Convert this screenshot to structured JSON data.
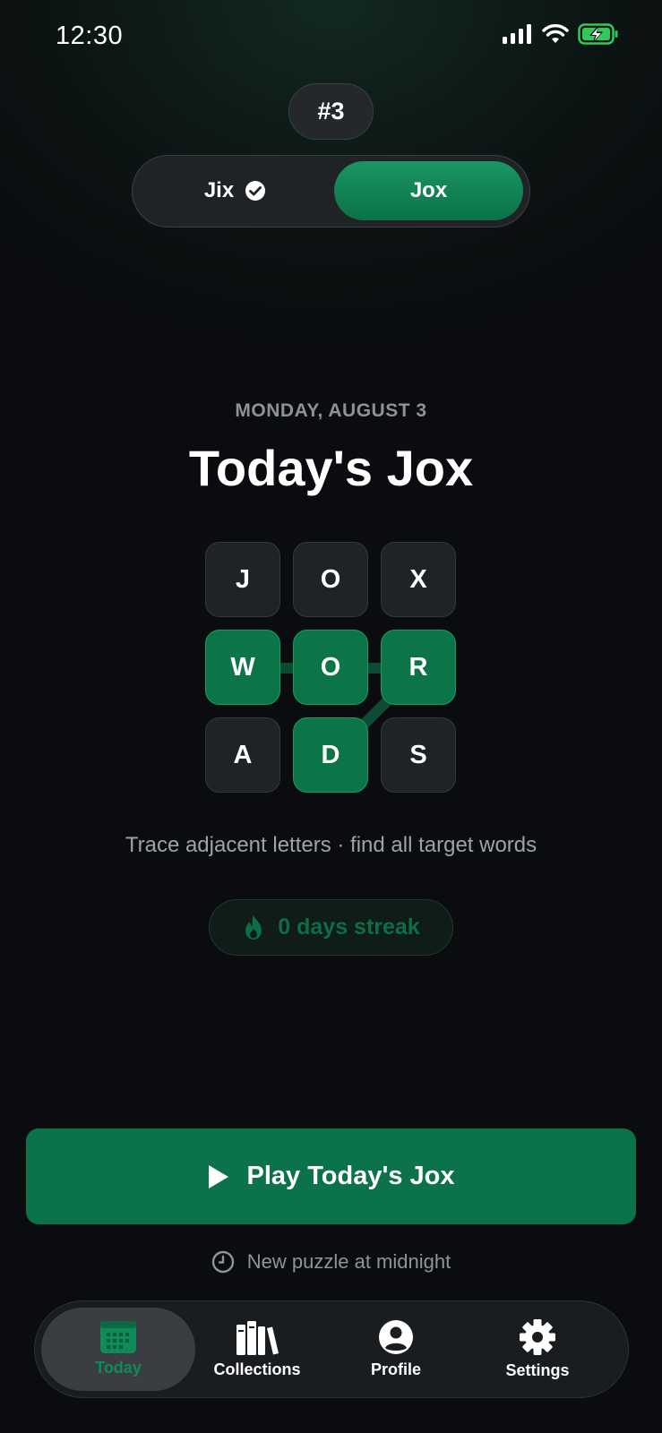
{
  "status": {
    "time": "12:30"
  },
  "header": {
    "puzzle_number": "#3",
    "segments": [
      {
        "label": "Jix",
        "completed": true
      },
      {
        "label": "Jox",
        "selected": true
      }
    ]
  },
  "main": {
    "date": "MONDAY, AUGUST 3",
    "title": "Today's Jox",
    "grid": {
      "rows": [
        [
          {
            "letter": "J",
            "highlighted": false
          },
          {
            "letter": "O",
            "highlighted": false
          },
          {
            "letter": "X",
            "highlighted": false
          }
        ],
        [
          {
            "letter": "W",
            "highlighted": true
          },
          {
            "letter": "O",
            "highlighted": true
          },
          {
            "letter": "R",
            "highlighted": true
          }
        ],
        [
          {
            "letter": "A",
            "highlighted": false
          },
          {
            "letter": "D",
            "highlighted": true
          },
          {
            "letter": "S",
            "highlighted": false
          }
        ]
      ]
    },
    "hint": "Trace adjacent letters · find all target words",
    "streak": "0 days streak",
    "play_label": "Play Today's Jox",
    "next_puzzle": "New puzzle at midnight"
  },
  "tabbar": {
    "items": [
      {
        "label": "Today",
        "icon": "calendar-icon",
        "active": true
      },
      {
        "label": "Collections",
        "icon": "books-icon"
      },
      {
        "label": "Profile",
        "icon": "profile-icon"
      },
      {
        "label": "Settings",
        "icon": "gear-icon"
      }
    ]
  },
  "colors": {
    "accent": "#0b7249",
    "accent_light": "#1b9564",
    "background": "#0a0c0f"
  }
}
